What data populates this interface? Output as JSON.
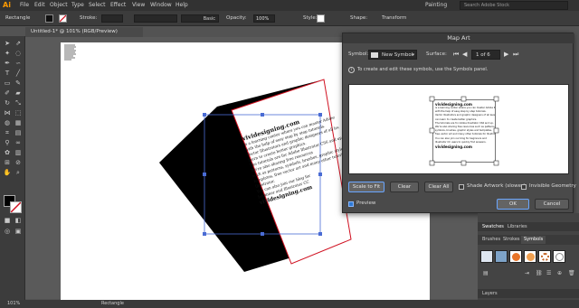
{
  "menubar": {
    "logo": "Ai",
    "items": [
      "File",
      "Edit",
      "Object",
      "Type",
      "Select",
      "Effect",
      "View",
      "Window",
      "Help"
    ],
    "workspace": "Painting",
    "search_placeholder": "Search Adobe Stock"
  },
  "control_bar": {
    "selection_label": "Rectangle",
    "stroke_label": "Stroke:",
    "brush_label": "Basic",
    "opacity_label": "Opacity:",
    "opacity_value": "100%",
    "style_label": "Style:",
    "shape_label": "Shape:",
    "transform_label": "Transform"
  },
  "document_tab": {
    "label": "Untitled-1* @ 101% (RGB/Preview)"
  },
  "artwork": {
    "face_lines": [
      "vividesigning.com",
      "is a learning center where you can master Adobe Illustrator",
      "with the help of easy step by step tutorials.",
      "Vector Illustrators and graphic designers of all levels can",
      "learn to create better graphics.",
      "The tutorials are for Adobe Illustrator CS6 and up.",
      "We're also sharing free resources",
      "such as patterns, symbols, brushes, graphic styles and",
      "templates, free vector art and many other tutorials for",
      "Illustrator.",
      "You can also join our blog for",
      "beginner and Illustrator CC",
      "vividesigning.com"
    ]
  },
  "dialog": {
    "title": "Map Art",
    "symbol_label": "Symbol:",
    "symbol_value": "New Symbol",
    "surface_label": "Surface:",
    "surface_value": "1 of 6",
    "info_text": "To create and edit these symbols, use the Symbols panel.",
    "buttons": {
      "scale_to_fit": "Scale to Fit",
      "clear": "Clear",
      "clear_all": "Clear All",
      "ok": "OK",
      "cancel": "Cancel"
    },
    "shade_artwork_label": "Shade Artwork (slower)",
    "invisible_geometry_label": "Invisible Geometry",
    "preview_label": "Preview",
    "preview_checked": true,
    "preview_lines": [
      "vividesigning.com",
      "is a learning center where you can master Adobe Illustrator",
      "with the help of easy step by step tutorials.",
      "Vector Illustrators and graphic designers of all levels",
      "can learn to create better graphics.",
      "The tutorials are for Adobe Illustrator CS6 and up.",
      "We're also sharing free resources such as patterns,",
      "symbols, brushes, graphic styles and templates,",
      "free vector art and many other tutorials for Illustrator.",
      "You can also join our blog for beginners and",
      "Illustrator CC users to quickly find answers.",
      "vividesigning.com"
    ]
  },
  "panels": {
    "top_tabs": [
      "Swatches",
      "Libraries"
    ],
    "sub_tabs": [
      "Brushes",
      "Strokes",
      "Symbols"
    ],
    "bottom_tab": "Layers"
  },
  "statusbar": {
    "zoom": "101%",
    "tool": "Rectangle"
  },
  "colors": {
    "accent": "#2f7ad6",
    "selection_blue": "#4a6cd4",
    "spine_red": "#d01020",
    "logo_orange": "#ff9a00"
  }
}
